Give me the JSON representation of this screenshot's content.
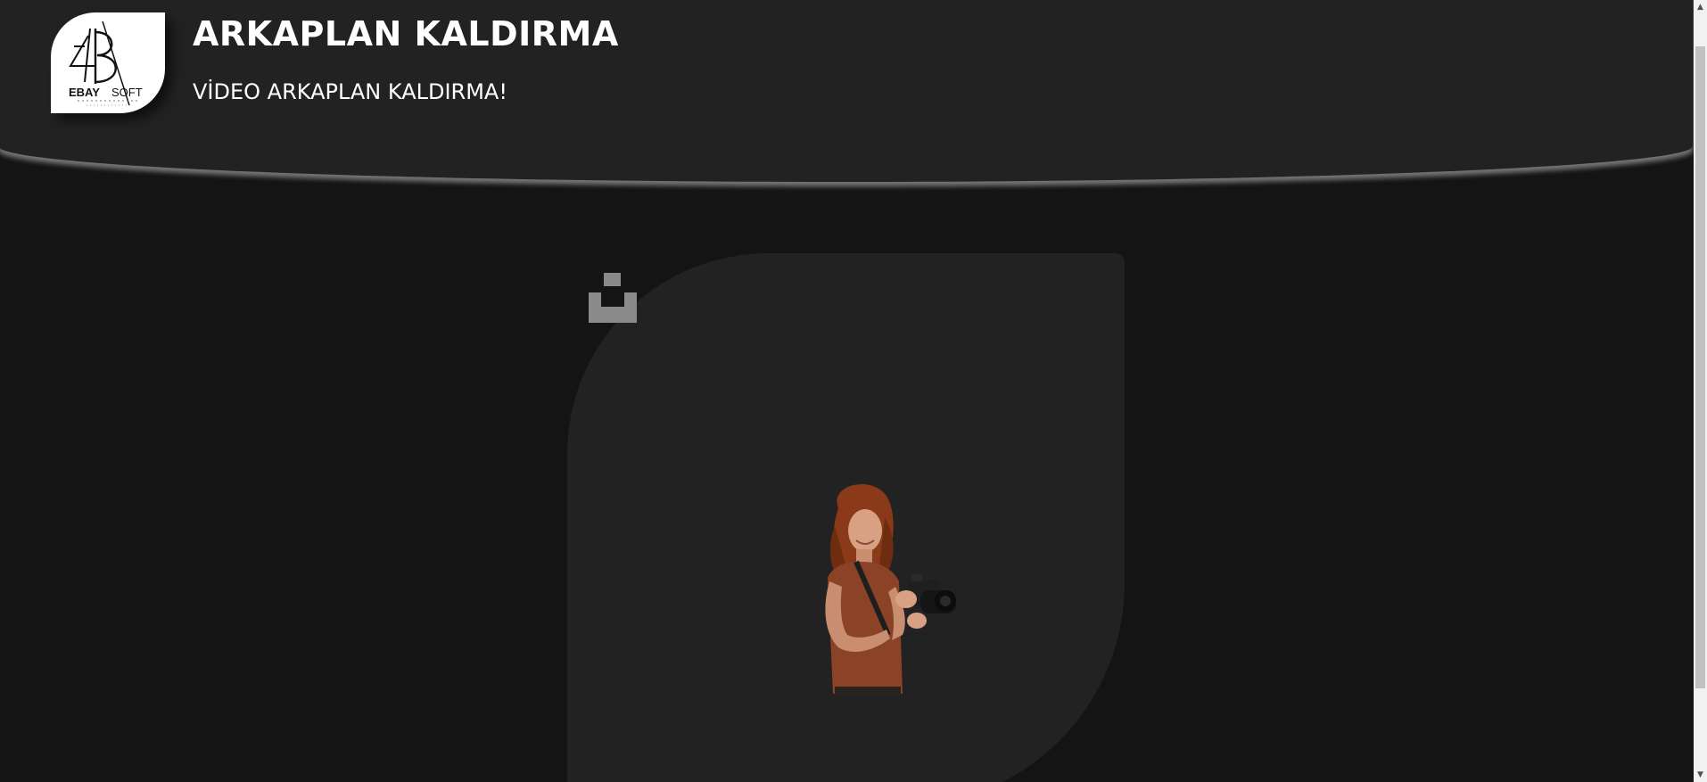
{
  "header": {
    "title": "ARKAPLAN KALDIRMA",
    "subtitle": "VİDEO ARKAPLAN KALDIRMA!",
    "logo": {
      "brand": "EBAY SOFT",
      "initials": "EB",
      "icon": "ebaysoft-logo-icon"
    }
  },
  "main": {
    "upload_icon": "upload-icon",
    "preview_image": "woman-with-camera-cutout-image"
  },
  "colors": {
    "page_background": "#141414",
    "header_background": "#222222",
    "card_background": "#222222",
    "icon_gray": "#8a8a8a",
    "text": "#ffffff"
  }
}
